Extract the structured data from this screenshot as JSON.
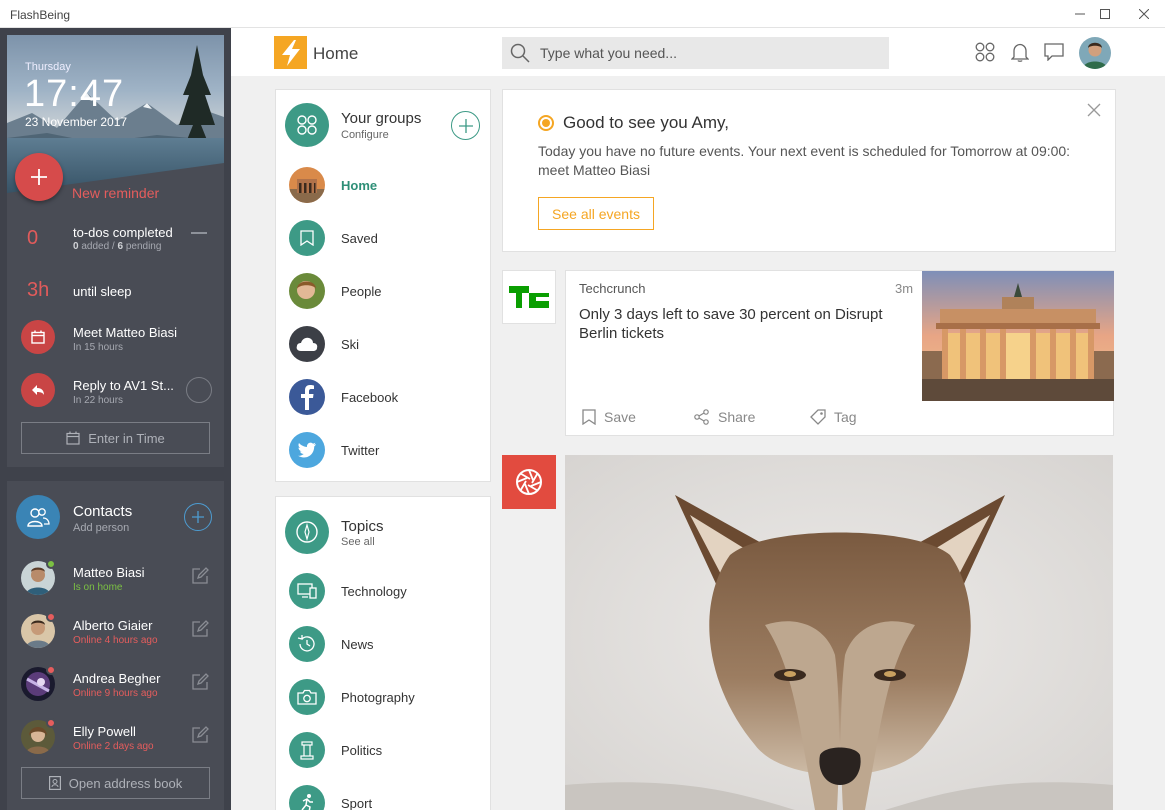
{
  "window": {
    "title": "FlashBeing"
  },
  "sidebar": {
    "day": "Thursday",
    "time": "17:47",
    "date": "23 November 2017",
    "new_reminder": "New reminder",
    "todos": {
      "count": "0",
      "title": "to-dos completed",
      "added": "0",
      "added_label": "added /",
      "pending": "6",
      "pending_label": "pending"
    },
    "sleep": {
      "value": "3h",
      "label": "until sleep"
    },
    "events": [
      {
        "title": "Meet Matteo Biasi",
        "sub": "In 15 hours"
      },
      {
        "title": "Reply to AV1 St...",
        "sub": "In 22 hours"
      }
    ],
    "enter_time": "Enter in Time",
    "contacts": {
      "title": "Contacts",
      "sub": "Add person",
      "items": [
        {
          "name": "Matteo Biasi",
          "status": "Is on home",
          "status_color": "#7bc043"
        },
        {
          "name": "Alberto Giaier",
          "status": "Online 4 hours ago",
          "status_color": "#e55d5d"
        },
        {
          "name": "Andrea Begher",
          "status": "Online 9 hours ago",
          "status_color": "#e55d5d"
        },
        {
          "name": "Elly Powell",
          "status": "Online 2 days ago",
          "status_color": "#e55d5d"
        }
      ]
    },
    "open_address_book": "Open address book"
  },
  "header": {
    "title": "Home",
    "search_placeholder": "Type what you need..."
  },
  "groups": {
    "title": "Your groups",
    "sub": "Configure",
    "items": [
      {
        "label": "Home"
      },
      {
        "label": "Saved"
      },
      {
        "label": "People"
      },
      {
        "label": "Ski"
      },
      {
        "label": "Facebook"
      },
      {
        "label": "Twitter"
      }
    ]
  },
  "topics": {
    "title": "Topics",
    "sub": "See all",
    "items": [
      {
        "label": "Technology"
      },
      {
        "label": "News"
      },
      {
        "label": "Photography"
      },
      {
        "label": "Politics"
      },
      {
        "label": "Sport"
      }
    ]
  },
  "welcome": {
    "title": "Good to see you Amy,",
    "text": "Today you have no future events. Your next event is scheduled for Tomorrow at 09:00: meet Matteo Biasi",
    "button": "See all events"
  },
  "news": {
    "source": "Techcrunch",
    "time": "3m",
    "title": "Only 3 days left to save 30 percent on Disrupt Berlin tickets",
    "actions": {
      "save": "Save",
      "share": "Share",
      "tag": "Tag"
    },
    "logo_text": "TC"
  },
  "colors": {
    "accent": "#f5a623",
    "teal": "#3d9a86",
    "red": "#d64b4b",
    "sidebar": "#3f424b"
  }
}
